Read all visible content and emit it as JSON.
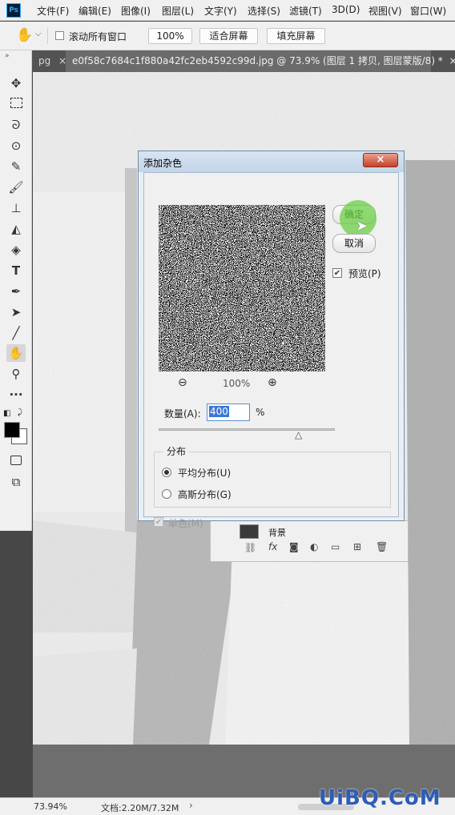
{
  "app": {
    "logo": "Ps"
  },
  "menu": [
    "文件(F)",
    "编辑(E)",
    "图像(I)",
    "图层(L)",
    "文字(Y)",
    "选择(S)",
    "滤镜(T)",
    "3D(D)",
    "视图(V)",
    "窗口(W)"
  ],
  "options": {
    "scroll_all_windows": "滚动所有窗口",
    "zoom": "100%",
    "fit_screen": "适合屏幕",
    "fill_screen": "填充屏幕"
  },
  "tabs": {
    "prev_tab": "pg",
    "active_tab": "e0f58c7684c1f880a42fc2eb4592c99d.jpg @ 73.9% (图层 1 拷贝, 图层蒙版/8) *",
    "close_glyph": "×"
  },
  "dialog": {
    "title": "添加杂色",
    "close": "×",
    "ok": "确定",
    "cancel": "取消",
    "preview_label": "预览(P)",
    "zoom_value": "100%",
    "amount_label": "数量(A):",
    "amount_value": "400",
    "amount_unit": "%",
    "amount_slider_fraction": 0.8,
    "distribution_title": "分布",
    "uniform": "平均分布(U)",
    "gaussian": "高斯分布(G)",
    "monochromatic": "单色(M)"
  },
  "layers": {
    "layer_name": "背景"
  },
  "status": {
    "zoom": "73.94%",
    "doc": "文档:2.20M/7.32M"
  },
  "watermark": "UiBQ.CoM",
  "colors": {
    "accent_green": "#6ccf46",
    "ps_blue": "#31a8ff"
  }
}
